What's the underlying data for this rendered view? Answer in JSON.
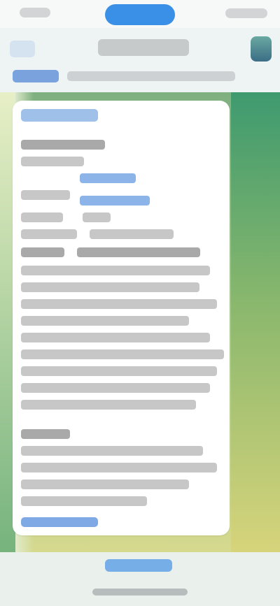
{
  "status_bar": {
    "time": "",
    "pill_color": "#3a8fe6"
  },
  "header": {
    "title": "",
    "subtitle_link": "",
    "subtitle_text": ""
  },
  "message": {
    "header": "",
    "footer_link": ""
  },
  "bottom_bar": {
    "link": ""
  },
  "colors": {
    "chat_bg_top": "#3e9a6f",
    "chat_bg_bottom": "#d7d47b",
    "bubble": "#ffffff",
    "link": "#3a8fe6"
  },
  "icons": {
    "back": "chevron-left-icon",
    "avatar": "contact-avatar"
  }
}
